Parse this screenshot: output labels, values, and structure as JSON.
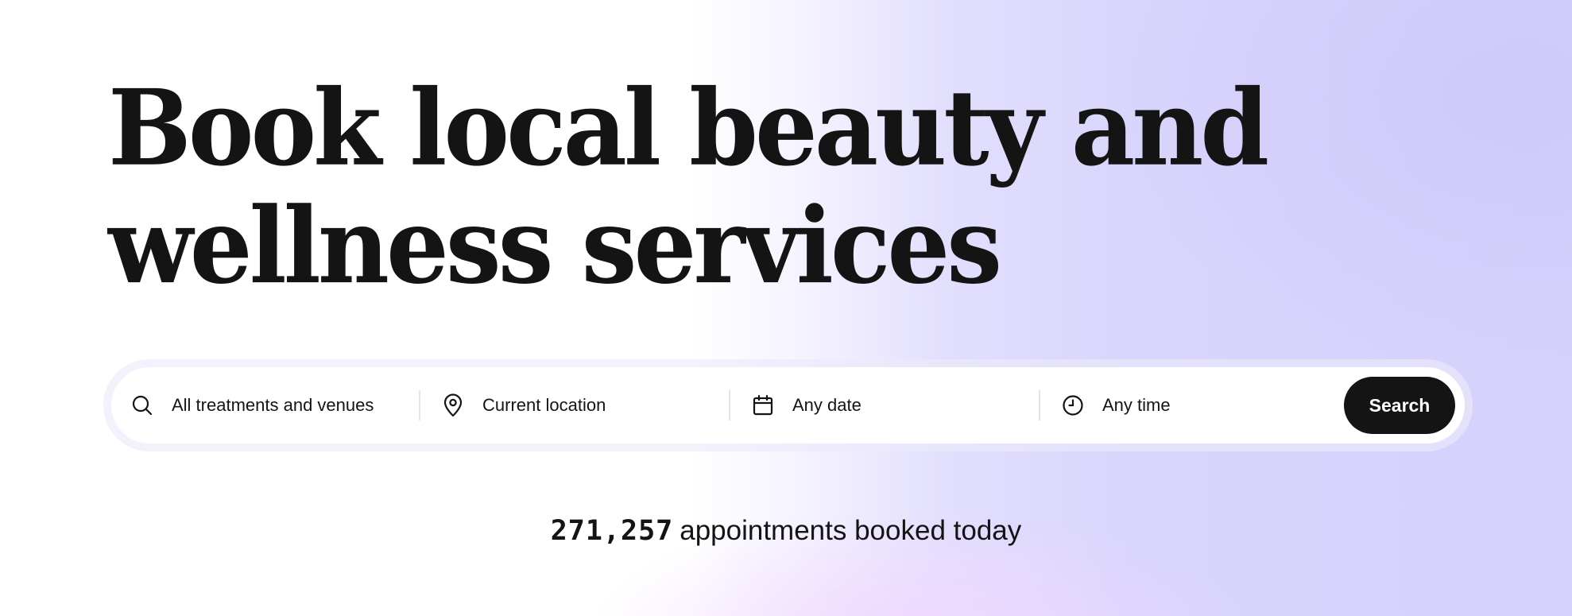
{
  "hero": {
    "title_line1": "Book local beauty and",
    "title_line2": "wellness services"
  },
  "search": {
    "treatment": {
      "label": "All treatments and venues",
      "icon": "search-icon"
    },
    "location": {
      "label": "Current location",
      "icon": "location-pin-icon"
    },
    "date": {
      "label": "Any date",
      "icon": "calendar-icon"
    },
    "time": {
      "label": "Any time",
      "icon": "clock-icon"
    },
    "button_label": "Search"
  },
  "stats": {
    "count": "271,257",
    "suffix": "appointments booked today"
  },
  "colors": {
    "text": "#141414",
    "button_bg": "#141414",
    "button_text": "#ffffff",
    "accent_gradient": "#d5d1fb"
  }
}
